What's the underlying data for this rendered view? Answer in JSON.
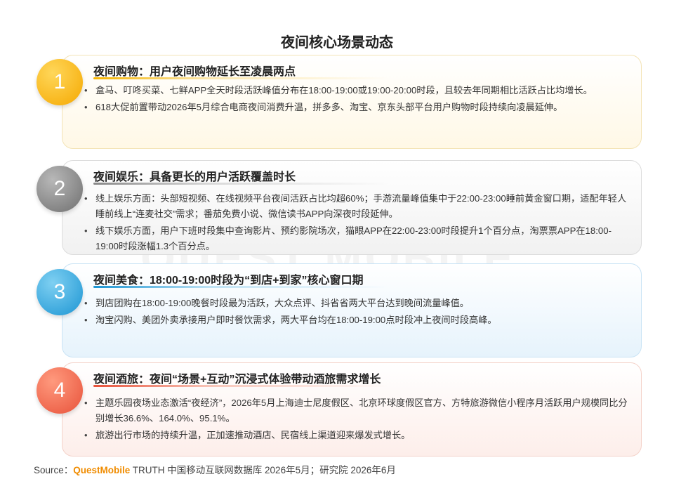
{
  "page": {
    "title": "夜间核心场景动态"
  },
  "watermark": "QUEST MOBILE",
  "cards": [
    {
      "number": "1",
      "title": "夜间购物：用户夜间购物延长至凌晨两点",
      "bullets": [
        "盒马、叮咚买菜、七鲜APP全天时段活跃峰值分布在18:00-19:00或19:00-20:00时段，且较去年同期相比活跃占比均增长。",
        "618大促前置带动2026年5月综合电商夜间消费升温，拼多多、淘宝、京东头部平台用户购物时段持续向凌晨延伸。"
      ]
    },
    {
      "number": "2",
      "title": "夜间娱乐：具备更长的用户活跃覆盖时长",
      "bullets": [
        "线上娱乐方面：头部短视频、在线视频平台夜间活跃占比均超60%；手游流量峰值集中于22:00-23:00睡前黄金窗口期，适配年轻人睡前线上“连麦社交”需求；番茄免费小说、微信读书APP向深夜时段延伸。",
        "线下娱乐方面，用户下班时段集中查询影片、预约影院场次，猫眼APP在22:00-23:00时段提升1个百分点，淘票票APP在18:00-19:00时段涨幅1.3个百分点。"
      ]
    },
    {
      "number": "3",
      "title": "夜间美食：18:00-19:00时段为“到店+到家”核心窗口期",
      "bullets": [
        "到店团购在18:00-19:00晚餐时段最为活跃，大众点评、抖省省两大平台达到晚间流量峰值。",
        "淘宝闪购、美团外卖承接用户即时餐饮需求，两大平台均在18:00-19:00点时段冲上夜间时段高峰。"
      ]
    },
    {
      "number": "4",
      "title": "夜间酒旅：夜间“场景+互动”沉浸式体验带动酒旅需求增长",
      "bullets": [
        "主题乐园夜场业态激活“夜经济”，2026年5月上海迪士尼度假区、北京环球度假区官方、方特旅游微信小程序月活跃用户规模同比分别增长36.6%、164.0%、95.1%。",
        "旅游出行市场的持续升温，正加速推动酒店、民宿线上渠道迎来爆发式增长。"
      ]
    }
  ],
  "bullet_symbol": "•",
  "source": {
    "label": "Source：",
    "brand": "QuestMobile",
    "text": " TRUTH 中国移动互联网数据库 2026年5月；研究院 2026年6月"
  },
  "colors": {
    "card1_accent": "#f5b400",
    "card2_accent": "#888888",
    "card3_accent": "#1c95d3",
    "card4_accent": "#e8523a",
    "brand": "#f08c00"
  }
}
